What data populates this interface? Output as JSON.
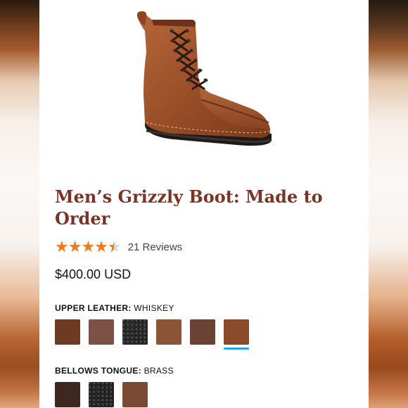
{
  "product": {
    "title": "Men’s Grizzly Boot: Made to Order",
    "rating": 4.5,
    "reviews_label": "21 Reviews",
    "price": "$400.00 USD"
  },
  "options": {
    "upper_leather": {
      "label": "UPPER LEATHER:",
      "value": "WHISKEY",
      "swatches": [
        {
          "color": "#6e3a22"
        },
        {
          "color": "#7c5246"
        },
        {
          "color": "#2a2a2a"
        },
        {
          "color": "#8b5535"
        },
        {
          "color": "#6b4334"
        },
        {
          "color": "#8a4a2b",
          "selected": true
        }
      ]
    },
    "bellows_tongue": {
      "label": "BELLOWS TONGUE:",
      "value": "BRASS",
      "swatches": [
        {
          "color": "#3e2621"
        },
        {
          "color": "#262626"
        },
        {
          "color": "#7a4a34"
        }
      ]
    }
  },
  "colors": {
    "title": "#7a3426",
    "star": "#f07a1c",
    "selected_underline": "#29a6e8"
  }
}
